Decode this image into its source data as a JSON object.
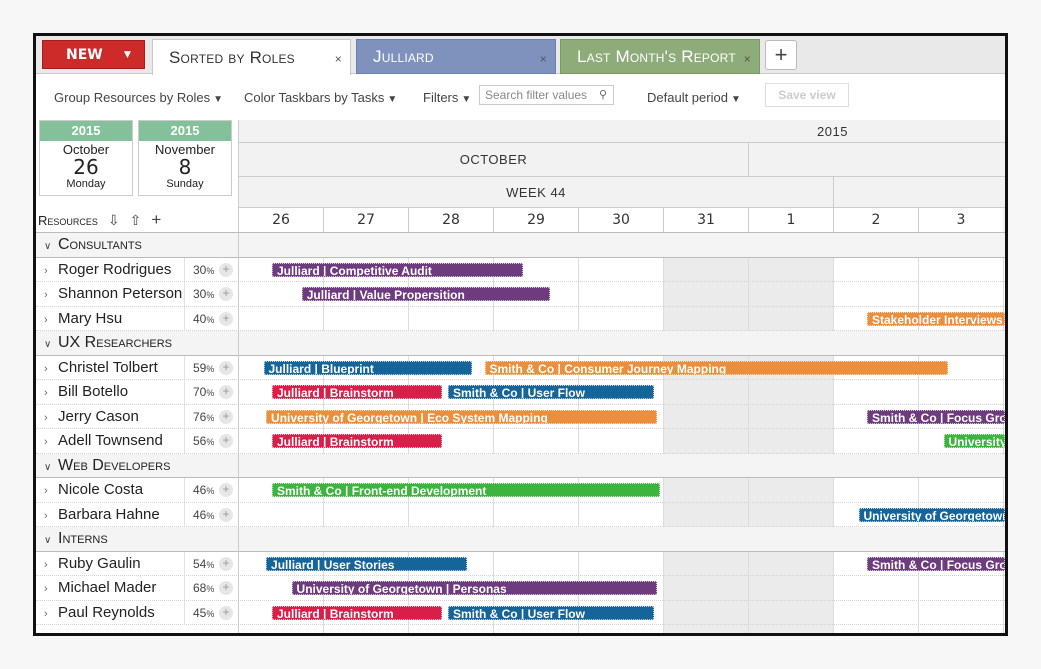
{
  "tabbar": {
    "new_label": "NEW",
    "new_caret": "▼",
    "tabs": [
      {
        "label": "Sorted by Roles",
        "close": "×"
      },
      {
        "label": "Julliard",
        "close": "×"
      },
      {
        "label": "Last Month's Report",
        "close": "×"
      }
    ],
    "add_label": "+"
  },
  "toolbar": {
    "group_label": "Group Resources by Roles",
    "color_label": "Color Taskbars by Tasks",
    "filters_label": "Filters",
    "search_placeholder": "Search filter values",
    "period_label": "Default period",
    "save_label": "Save view",
    "caret": "▼"
  },
  "date_range": {
    "start": {
      "year": "2015",
      "month": "October",
      "day": "26",
      "weekday": "Monday"
    },
    "end": {
      "year": "2015",
      "month": "November",
      "day": "8",
      "weekday": "Sunday"
    }
  },
  "timeline": {
    "year": "2015",
    "month": "OCTOBER",
    "week": "WEEK 44",
    "days": [
      "26",
      "27",
      "28",
      "29",
      "30",
      "31",
      "1",
      "2",
      "3"
    ]
  },
  "resources_header": {
    "label": "Resources",
    "collapse_all": "⇩",
    "expand_all": "⇧",
    "add": "+"
  },
  "groups": [
    {
      "name": "Consultants",
      "people": [
        {
          "name": "Roger Rodrigues",
          "pct": "30",
          "unit": "%",
          "bars": [
            {
              "label": "Julliard | Competitive Audit",
              "color": "purple",
              "start": 0.4,
              "end": 3.35
            }
          ]
        },
        {
          "name": "Shannon Peterson",
          "pct": "30",
          "unit": "%",
          "bars": [
            {
              "label": "Julliard | Value Propersition",
              "color": "purple",
              "start": 0.75,
              "end": 3.67
            }
          ]
        },
        {
          "name": "Mary Hsu",
          "pct": "40",
          "unit": "%",
          "bars": [
            {
              "label": "Stakeholder Interviews",
              "color": "orange",
              "start": 7.4,
              "end": 9.2
            }
          ]
        }
      ]
    },
    {
      "name": "UX Researchers",
      "people": [
        {
          "name": "Christel Tolbert",
          "pct": "59",
          "unit": "%",
          "bars": [
            {
              "label": "Julliard | Blueprint",
              "color": "blue",
              "start": 0.3,
              "end": 2.75
            },
            {
              "label": "Smith & Co | Consumer Journey Mapping",
              "color": "orange",
              "start": 2.9,
              "end": 8.35
            }
          ]
        },
        {
          "name": "Bill Botello",
          "pct": "70",
          "unit": "%",
          "bars": [
            {
              "label": "Julliard | Brainstorm",
              "color": "red",
              "start": 0.4,
              "end": 2.4
            },
            {
              "label": "Smith & Co | User Flow",
              "color": "blue",
              "start": 2.47,
              "end": 4.9
            }
          ]
        },
        {
          "name": "Jerry Cason",
          "pct": "76",
          "unit": "%",
          "bars": [
            {
              "label": "University of Georgetown | Eco System Mapping",
              "color": "orange",
              "start": 0.33,
              "end": 4.93
            },
            {
              "label": "Smith & Co | Focus Groups",
              "color": "purple",
              "start": 7.4,
              "end": 9.2
            }
          ]
        },
        {
          "name": "Adell Townsend",
          "pct": "56",
          "unit": "%",
          "bars": [
            {
              "label": "Julliard | Brainstorm",
              "color": "red",
              "start": 0.4,
              "end": 2.4
            },
            {
              "label": "University",
              "color": "green",
              "start": 8.3,
              "end": 9.2
            }
          ]
        }
      ]
    },
    {
      "name": "Web Developers",
      "people": [
        {
          "name": "Nicole Costa",
          "pct": "46",
          "unit": "%",
          "bars": [
            {
              "label": "Smith & Co | Front-end Development",
              "color": "green",
              "start": 0.4,
              "end": 4.97
            }
          ]
        },
        {
          "name": "Barbara Hahne",
          "pct": "46",
          "unit": "%",
          "bars": [
            {
              "label": "University of Georgetown",
              "color": "blue",
              "start": 7.3,
              "end": 9.2
            }
          ]
        }
      ]
    },
    {
      "name": "Interns",
      "people": [
        {
          "name": "Ruby Gaulin",
          "pct": "54",
          "unit": "%",
          "bars": [
            {
              "label": "Julliard | User Stories",
              "color": "blue",
              "start": 0.33,
              "end": 2.7
            },
            {
              "label": "Smith & Co | Focus Groups",
              "color": "purple",
              "start": 7.4,
              "end": 9.2
            }
          ]
        },
        {
          "name": "Michael Mader",
          "pct": "68",
          "unit": "%",
          "bars": [
            {
              "label": "University of Georgetown | Personas",
              "color": "purple",
              "start": 0.63,
              "end": 4.93
            }
          ]
        },
        {
          "name": "Paul Reynolds",
          "pct": "45",
          "unit": "%",
          "bars": [
            {
              "label": "Julliard | Brainstorm",
              "color": "red",
              "start": 0.4,
              "end": 2.4
            },
            {
              "label": "Smith & Co | User Flow",
              "color": "blue",
              "start": 2.47,
              "end": 4.9
            }
          ]
        }
      ]
    }
  ]
}
